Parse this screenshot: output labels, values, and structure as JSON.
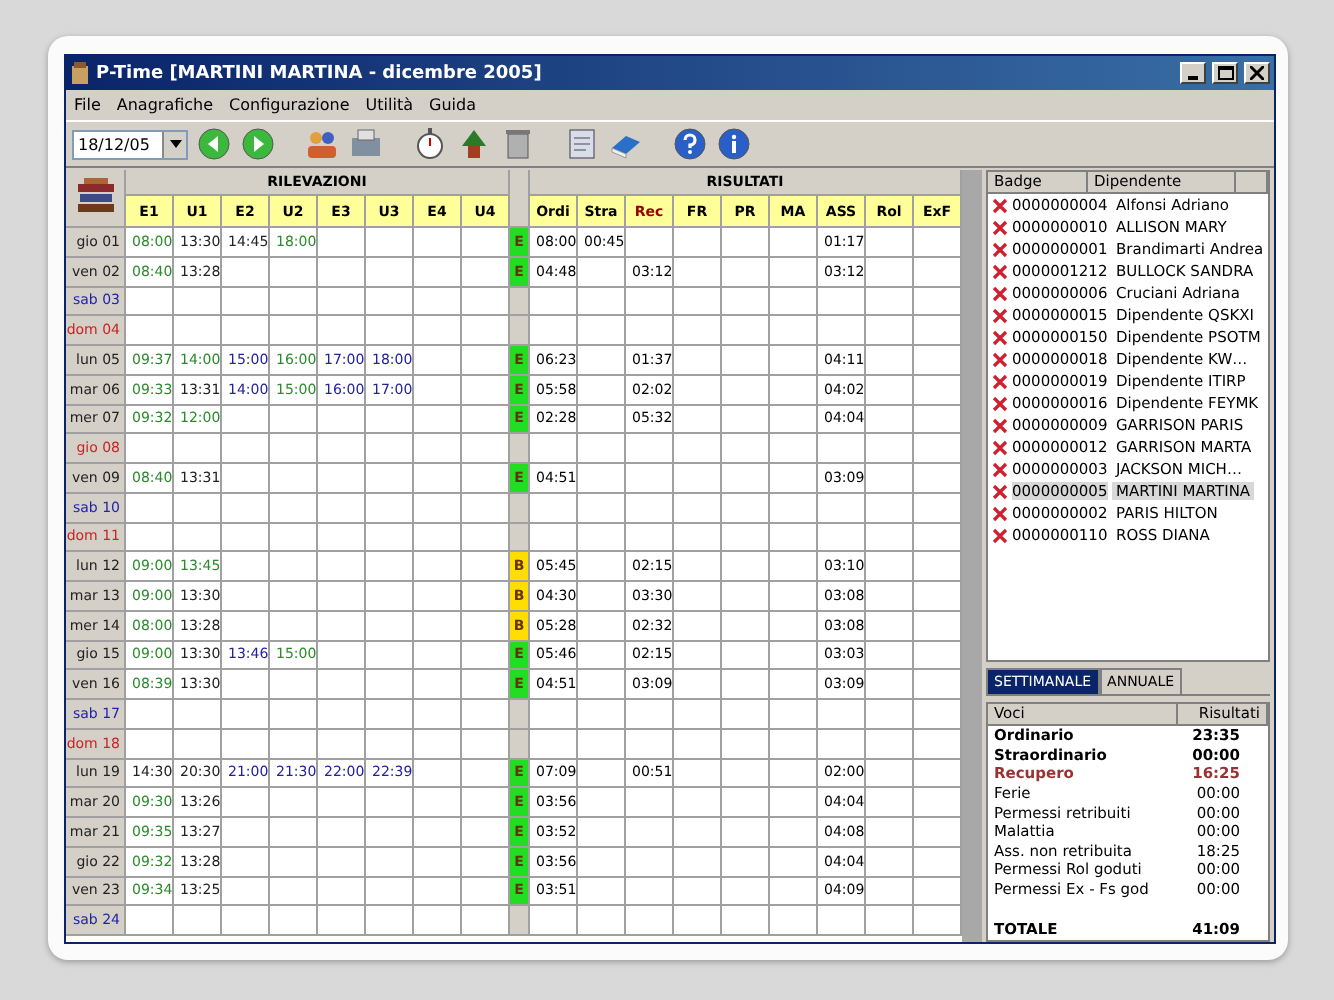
{
  "window": {
    "title": "P-Time [MARTINI MARTINA - dicembre 2005]"
  },
  "menu": [
    "File",
    "Anagrafiche",
    "Configurazione",
    "Utilità",
    "Guida"
  ],
  "toolbar": {
    "date": "18/12/05"
  },
  "grid": {
    "groups": [
      "RILEVAZIONI",
      "RISULTATI"
    ],
    "punch_columns": [
      "E1",
      "U1",
      "E2",
      "U2",
      "E3",
      "U3",
      "E4",
      "U4"
    ],
    "result_columns": [
      {
        "label": "Ordi",
        "highlight": false
      },
      {
        "label": "Stra",
        "highlight": false
      },
      {
        "label": "Rec",
        "highlight": true
      },
      {
        "label": "FR",
        "highlight": false
      },
      {
        "label": "PR",
        "highlight": false
      },
      {
        "label": "MA",
        "highlight": false
      },
      {
        "label": "ASS",
        "highlight": false
      },
      {
        "label": "Rol",
        "highlight": false
      },
      {
        "label": "ExF",
        "highlight": false
      }
    ],
    "rows": [
      {
        "day": "gio 01",
        "kind": "weekday",
        "punches": [
          {
            "time": "08:00",
            "color": "#2b8a2b"
          },
          {
            "time": "13:30",
            "color": "#222222"
          },
          {
            "time": "14:45",
            "color": "#222222"
          },
          {
            "time": "18:00",
            "color": "#2b8a2b"
          }
        ],
        "flag": {
          "text": "E",
          "color": "#22dd22"
        },
        "results": {
          "ordi": "08:00",
          "stra": "00:45",
          "ass": "01:17"
        }
      },
      {
        "day": "ven 02",
        "kind": "weekday",
        "punches": [
          {
            "time": "08:40",
            "color": "#2b8a2b"
          },
          {
            "time": "13:28",
            "color": "#222222"
          }
        ],
        "flag": {
          "text": "E",
          "color": "#22dd22"
        },
        "results": {
          "ordi": "04:48",
          "rec": "03:12",
          "ass": "03:12"
        }
      },
      {
        "day": "sab 03",
        "kind": "saturday"
      },
      {
        "day": "dom 04",
        "kind": "holiday"
      },
      {
        "day": "lun 05",
        "kind": "weekday",
        "punches": [
          {
            "time": "09:37",
            "color": "#2b8a2b"
          },
          {
            "time": "14:00",
            "color": "#2b8a2b"
          },
          {
            "time": "15:00",
            "color": "#22229a"
          },
          {
            "time": "16:00",
            "color": "#2b8a2b"
          },
          {
            "time": "17:00",
            "color": "#22229a"
          },
          {
            "time": "18:00",
            "color": "#22229a"
          }
        ],
        "flag": {
          "text": "E",
          "color": "#22dd22"
        },
        "results": {
          "ordi": "06:23",
          "rec": "01:37",
          "ass": "04:11"
        }
      },
      {
        "day": "mar 06",
        "kind": "weekday",
        "punches": [
          {
            "time": "09:33",
            "color": "#2b8a2b"
          },
          {
            "time": "13:31",
            "color": "#222222"
          },
          {
            "time": "14:00",
            "color": "#22229a"
          },
          {
            "time": "15:00",
            "color": "#2b8a2b"
          },
          {
            "time": "16:00",
            "color": "#22229a"
          },
          {
            "time": "17:00",
            "color": "#22229a"
          }
        ],
        "flag": {
          "text": "E",
          "color": "#22dd22"
        },
        "results": {
          "ordi": "05:58",
          "rec": "02:02",
          "ass": "04:02"
        }
      },
      {
        "day": "mer 07",
        "kind": "weekday",
        "punches": [
          {
            "time": "09:32",
            "color": "#2b8a2b"
          },
          {
            "time": "12:00",
            "color": "#2b8a2b"
          }
        ],
        "flag": {
          "text": "E",
          "color": "#22dd22"
        },
        "results": {
          "ordi": "02:28",
          "rec": "05:32",
          "ass": "04:04"
        }
      },
      {
        "day": "gio 08",
        "kind": "holiday"
      },
      {
        "day": "ven 09",
        "kind": "weekday",
        "punches": [
          {
            "time": "08:40",
            "color": "#2b8a2b"
          },
          {
            "time": "13:31",
            "color": "#222222"
          }
        ],
        "flag": {
          "text": "E",
          "color": "#22dd22"
        },
        "results": {
          "ordi": "04:51",
          "ass": "03:09"
        }
      },
      {
        "day": "sab 10",
        "kind": "saturday"
      },
      {
        "day": "dom 11",
        "kind": "holiday"
      },
      {
        "day": "lun 12",
        "kind": "weekday",
        "punches": [
          {
            "time": "09:00",
            "color": "#2b8a2b"
          },
          {
            "time": "13:45",
            "color": "#2b8a2b"
          }
        ],
        "flag": {
          "text": "B",
          "color": "#ffdd00"
        },
        "results": {
          "ordi": "05:45",
          "rec": "02:15",
          "ass": "03:10"
        }
      },
      {
        "day": "mar 13",
        "kind": "weekday",
        "punches": [
          {
            "time": "09:00",
            "color": "#2b8a2b"
          },
          {
            "time": "13:30",
            "color": "#222222"
          }
        ],
        "flag": {
          "text": "B",
          "color": "#ffdd00"
        },
        "results": {
          "ordi": "04:30",
          "rec": "03:30",
          "ass": "03:08"
        }
      },
      {
        "day": "mer 14",
        "kind": "weekday",
        "punches": [
          {
            "time": "08:00",
            "color": "#2b8a2b"
          },
          {
            "time": "13:28",
            "color": "#222222"
          }
        ],
        "flag": {
          "text": "B",
          "color": "#ffdd00"
        },
        "results": {
          "ordi": "05:28",
          "rec": "02:32",
          "ass": "03:08"
        }
      },
      {
        "day": "gio 15",
        "kind": "weekday",
        "punches": [
          {
            "time": "09:00",
            "color": "#2b8a2b"
          },
          {
            "time": "13:30",
            "color": "#222222"
          },
          {
            "time": "13:46",
            "color": "#22229a"
          },
          {
            "time": "15:00",
            "color": "#2b8a2b"
          }
        ],
        "flag": {
          "text": "E",
          "color": "#22dd22"
        },
        "results": {
          "ordi": "05:46",
          "rec": "02:15",
          "ass": "03:03"
        }
      },
      {
        "day": "ven 16",
        "kind": "weekday",
        "punches": [
          {
            "time": "08:39",
            "color": "#2b8a2b"
          },
          {
            "time": "13:30",
            "color": "#222222"
          }
        ],
        "flag": {
          "text": "E",
          "color": "#22dd22"
        },
        "results": {
          "ordi": "04:51",
          "rec": "03:09",
          "ass": "03:09"
        }
      },
      {
        "day": "sab 17",
        "kind": "saturday"
      },
      {
        "day": "dom 18",
        "kind": "holiday"
      },
      {
        "day": "lun 19",
        "kind": "weekday",
        "punches": [
          {
            "time": "14:30",
            "color": "#222222"
          },
          {
            "time": "20:30",
            "color": "#222222"
          },
          {
            "time": "21:00",
            "color": "#22229a"
          },
          {
            "time": "21:30",
            "color": "#22229a"
          },
          {
            "time": "22:00",
            "color": "#22229a"
          },
          {
            "time": "22:39",
            "color": "#22229a"
          }
        ],
        "flag": {
          "text": "E",
          "color": "#22dd22"
        },
        "results": {
          "ordi": "07:09",
          "rec": "00:51",
          "ass": "02:00"
        }
      },
      {
        "day": "mar 20",
        "kind": "weekday",
        "punches": [
          {
            "time": "09:30",
            "color": "#2b8a2b"
          },
          {
            "time": "13:26",
            "color": "#222222"
          }
        ],
        "flag": {
          "text": "E",
          "color": "#22dd22"
        },
        "results": {
          "ordi": "03:56",
          "ass": "04:04"
        }
      },
      {
        "day": "mar 21",
        "kind": "weekday",
        "punches": [
          {
            "time": "09:35",
            "color": "#2b8a2b"
          },
          {
            "time": "13:27",
            "color": "#222222"
          }
        ],
        "flag": {
          "text": "E",
          "color": "#22dd22"
        },
        "results": {
          "ordi": "03:52",
          "ass": "04:08"
        }
      },
      {
        "day": "gio 22",
        "kind": "weekday",
        "punches": [
          {
            "time": "09:32",
            "color": "#2b8a2b"
          },
          {
            "time": "13:28",
            "color": "#222222"
          }
        ],
        "flag": {
          "text": "E",
          "color": "#22dd22"
        },
        "results": {
          "ordi": "03:56",
          "ass": "04:04"
        }
      },
      {
        "day": "ven 23",
        "kind": "weekday",
        "punches": [
          {
            "time": "09:34",
            "color": "#2b8a2b"
          },
          {
            "time": "13:25",
            "color": "#222222"
          }
        ],
        "flag": {
          "text": "E",
          "color": "#22dd22"
        },
        "results": {
          "ordi": "03:51",
          "ass": "04:09"
        }
      },
      {
        "day": "sab 24",
        "kind": "saturday"
      }
    ]
  },
  "employees": {
    "columns": [
      "Badge",
      "Dipendente"
    ],
    "items": [
      {
        "badge": "0000000004",
        "name": "Alfonsi Adriano",
        "selected": false
      },
      {
        "badge": "0000000010",
        "name": "ALLISON MARY",
        "selected": false
      },
      {
        "badge": "0000000001",
        "name": "Brandimarti Andrea",
        "selected": false
      },
      {
        "badge": "0000001212",
        "name": "BULLOCK SANDRA",
        "selected": false
      },
      {
        "badge": "0000000006",
        "name": "Cruciani Adriana",
        "selected": false
      },
      {
        "badge": "0000000015",
        "name": "Dipendente QSKXI",
        "selected": false
      },
      {
        "badge": "0000000150",
        "name": "Dipendente PSOTM",
        "selected": false
      },
      {
        "badge": "0000000018",
        "name": "Dipendente KW…",
        "selected": false
      },
      {
        "badge": "0000000019",
        "name": "Dipendente ITIRP",
        "selected": false
      },
      {
        "badge": "0000000016",
        "name": "Dipendente FEYMK",
        "selected": false
      },
      {
        "badge": "0000000009",
        "name": "GARRISON PARIS",
        "selected": false
      },
      {
        "badge": "0000000012",
        "name": "GARRISON MARTA",
        "selected": false
      },
      {
        "badge": "0000000003",
        "name": "JACKSON MICH…",
        "selected": false
      },
      {
        "badge": "0000000005",
        "name": "MARTINI MARTINA",
        "selected": true
      },
      {
        "badge": "0000000002",
        "name": "PARIS HILTON",
        "selected": false
      },
      {
        "badge": "0000000110",
        "name": "ROSS DIANA",
        "selected": false
      }
    ]
  },
  "summary": {
    "tabs": [
      {
        "label": "SETTIMANALE",
        "selected": true
      },
      {
        "label": "ANNUALE",
        "selected": false
      }
    ],
    "columns": [
      "Voci",
      "Risultati"
    ],
    "rows": [
      {
        "label": "Ordinario",
        "value": "23:35",
        "kind": "bold"
      },
      {
        "label": "Straordinario",
        "value": "00:00",
        "kind": "bold"
      },
      {
        "label": "Recupero",
        "value": "16:25",
        "kind": "accent"
      },
      {
        "label": "Ferie",
        "value": "00:00",
        "kind": "normal"
      },
      {
        "label": "Permessi retribuiti",
        "value": "00:00",
        "kind": "normal"
      },
      {
        "label": "Malattia",
        "value": "00:00",
        "kind": "normal"
      },
      {
        "label": "Ass. non retribuita",
        "value": "18:25",
        "kind": "normal"
      },
      {
        "label": "Permessi Rol goduti",
        "value": "00:00",
        "kind": "normal"
      },
      {
        "label": "Permessi Ex - Fs god",
        "value": "00:00",
        "kind": "normal"
      },
      {
        "label": "TOTALE",
        "value": "41:09",
        "kind": "total"
      }
    ]
  }
}
